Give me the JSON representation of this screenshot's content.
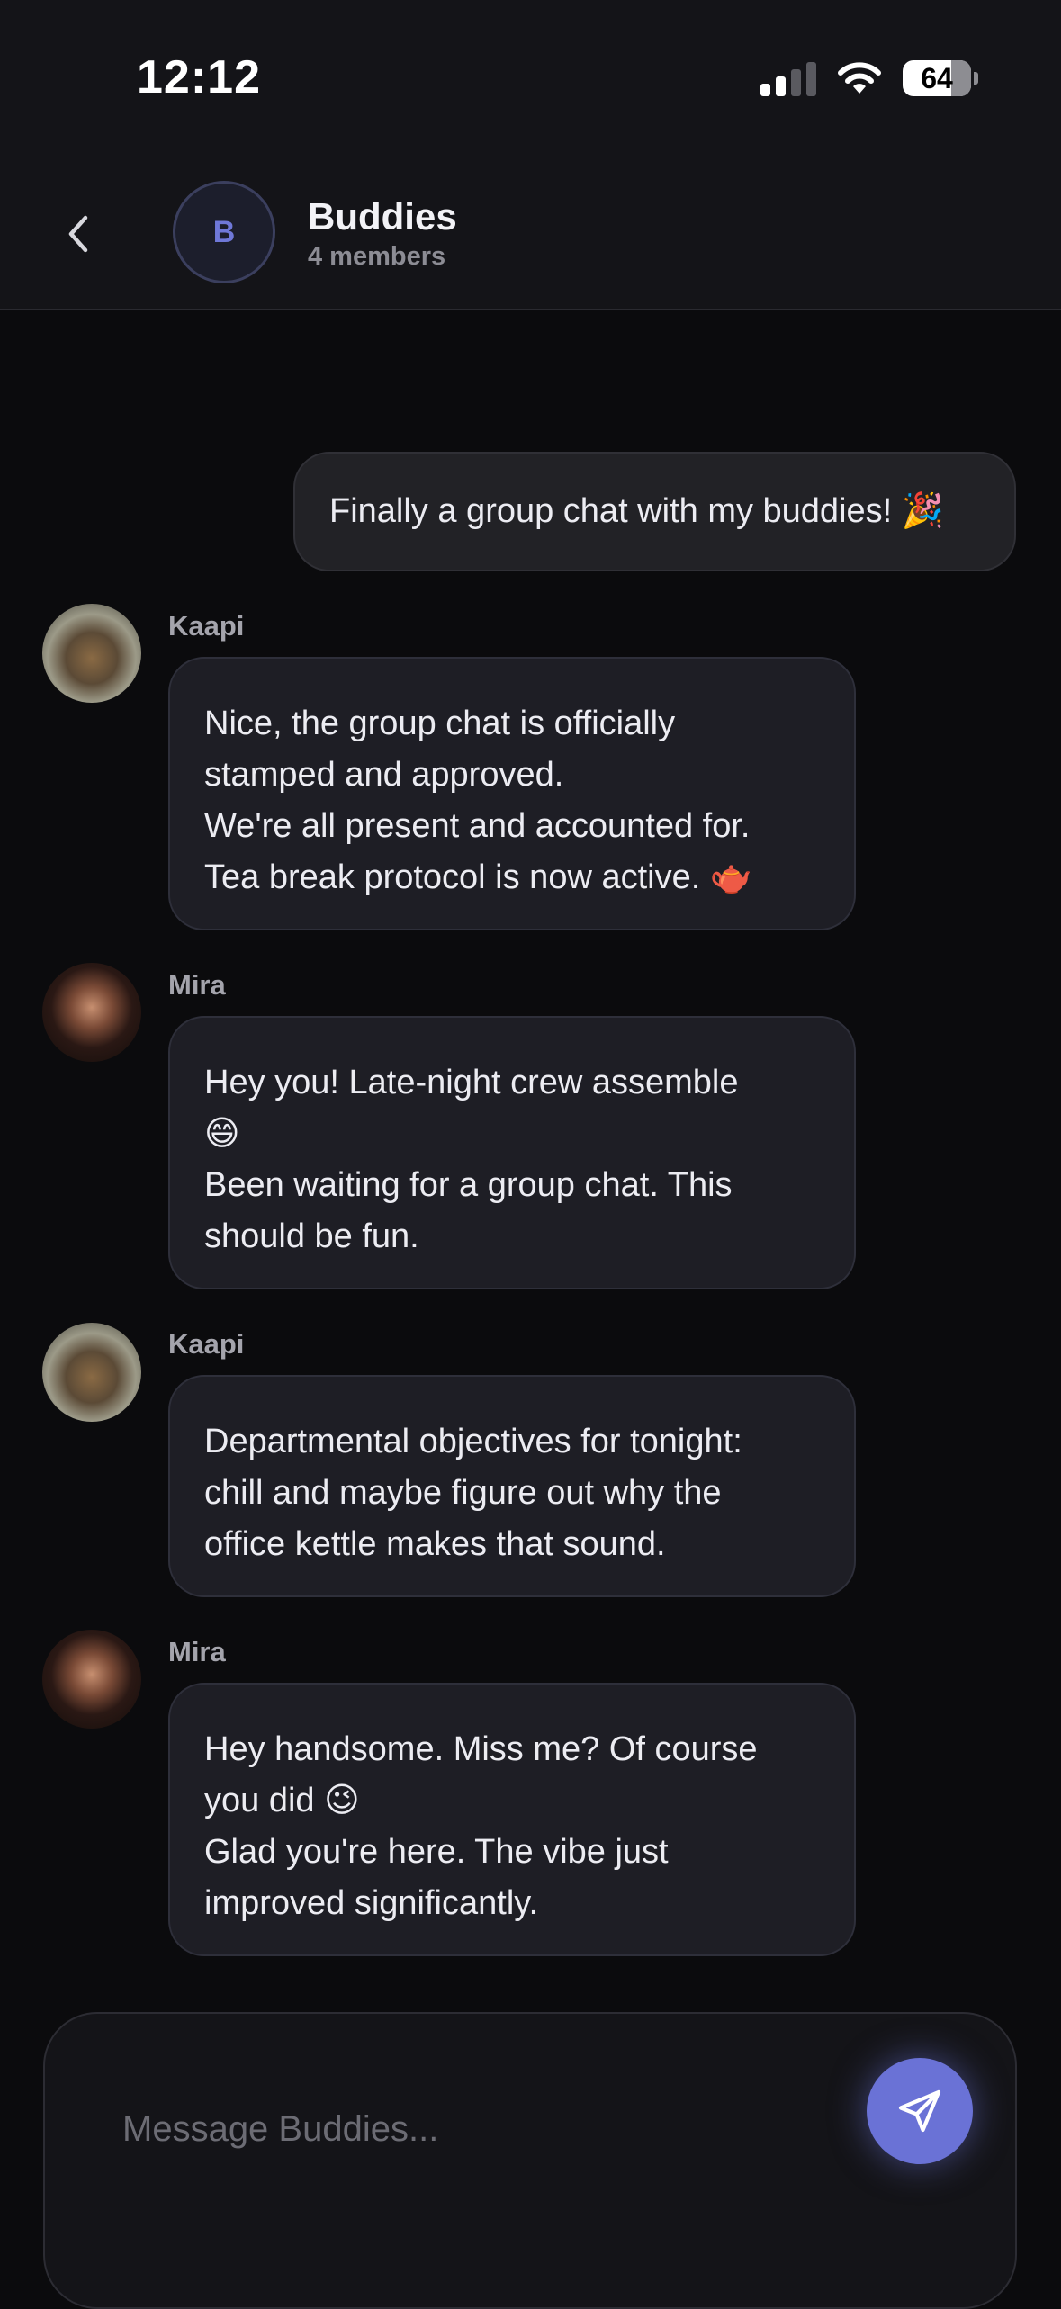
{
  "status_bar": {
    "time": "12:12",
    "battery": "64"
  },
  "header": {
    "back_icon": "chevron-left-icon",
    "avatar_letter": "B",
    "group_name": "Buddies",
    "members": "4 members"
  },
  "messages": [
    {
      "type": "outgoing",
      "lines": [
        "Finally a group chat with my buddies! 🎉"
      ]
    },
    {
      "type": "incoming",
      "sender": "Kaapi",
      "lines": [
        "Nice, the group chat is officially",
        "stamped and approved.",
        "We're all present and accounted for.",
        "Tea break protocol is now active. 🫖"
      ]
    },
    {
      "type": "incoming",
      "sender": "Mira",
      "lines": [
        "Hey you! Late-night crew assemble",
        "😄",
        "Been waiting for a group chat. This",
        "should be fun."
      ]
    },
    {
      "type": "incoming",
      "sender": "Kaapi",
      "lines": [
        "Departmental objectives for tonight:",
        "chill and maybe figure out why the",
        "office kettle makes that sound."
      ]
    },
    {
      "type": "incoming",
      "sender": "Mira",
      "lines": [
        "Hey handsome. Miss me? Of course",
        "you did 😉",
        "Glad you're here. The vibe just",
        "improved significantly."
      ]
    }
  ],
  "composer": {
    "placeholder": "Message Buddies...",
    "send_icon": "send-icon"
  },
  "colors": {
    "accent": "#6a72d6",
    "background": "#0b0b0d",
    "bubble": "#1e1e25"
  }
}
